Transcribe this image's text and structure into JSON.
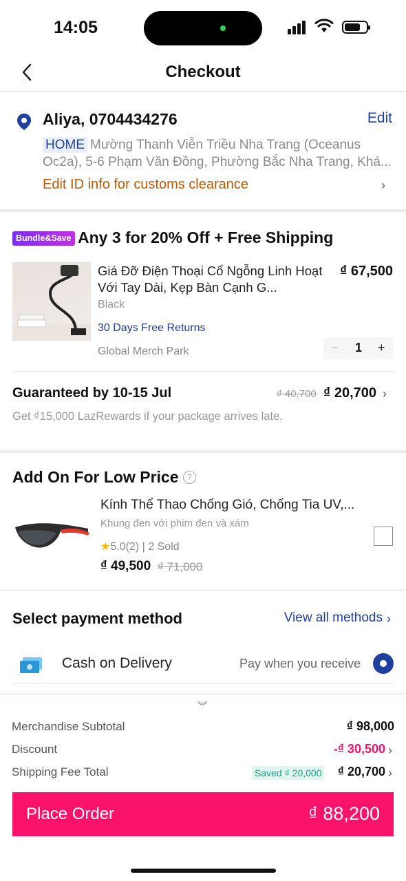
{
  "status_bar": {
    "time": "14:05"
  },
  "header": {
    "title": "Checkout"
  },
  "address": {
    "name_phone": "Aliya, 0704434276",
    "edit_label": "Edit",
    "tag": "HOME",
    "line1": "Mường Thanh Viễn Triều Nha Trang (Oceanus",
    "line2": "Oc2a), 5-6 Phạm Văn Đồng, Phường Bắc Nha Trang, Khá...",
    "customs_label": "Edit ID info for customs clearance"
  },
  "bundle": {
    "tag": "Bundle&Save",
    "title": "Any 3 for 20% Off + Free Shipping",
    "product": {
      "name": "Giá Đỡ Điện Thoại Cổ Ngỗng Linh Hoạt Với Tay Dài, Kẹp Bàn Cạnh G...",
      "price": "₫ 67,500",
      "variant": "Black",
      "returns": "30 Days Free Returns",
      "shop": "Global Merch Park",
      "qty": "1",
      "minus": "−",
      "plus": "+"
    },
    "delivery": {
      "guarantee": "Guaranteed by 10-15 Jul",
      "old_fee": "₫ 40,700",
      "new_fee": "₫ 20,700",
      "reward_note": "Get ₫15,000 LazRewards if your package arrives late."
    }
  },
  "addon": {
    "title": "Add On For Low Price",
    "help": "?",
    "item": {
      "name": "Kính Thể Thao Chống Gió, Chống Tia UV,...",
      "variant": "Khung đen với phim đen và xám",
      "rating": "5.0(2) | 2 Sold",
      "price": "₫ 49,500",
      "old_price": "₫ 71,000"
    }
  },
  "payment": {
    "title": "Select payment method",
    "view_all": "View all methods",
    "method": "Cash on Delivery",
    "method_note": "Pay when you receive"
  },
  "summary": {
    "subtotal_label": "Merchandise Subtotal",
    "subtotal": "₫ 98,000",
    "discount_label": "Discount",
    "discount": "-₫ 30,500",
    "shipping_label": "Shipping Fee Total",
    "saved": "Saved ₫ 20,000",
    "shipping": "₫ 20,700"
  },
  "place_order": {
    "label": "Place Order",
    "amount": "₫ 88,200"
  },
  "colors": {
    "accent": "#fb1269",
    "link": "#1e3f9e",
    "discount": "#f2156b",
    "warning": "#b85a06"
  }
}
